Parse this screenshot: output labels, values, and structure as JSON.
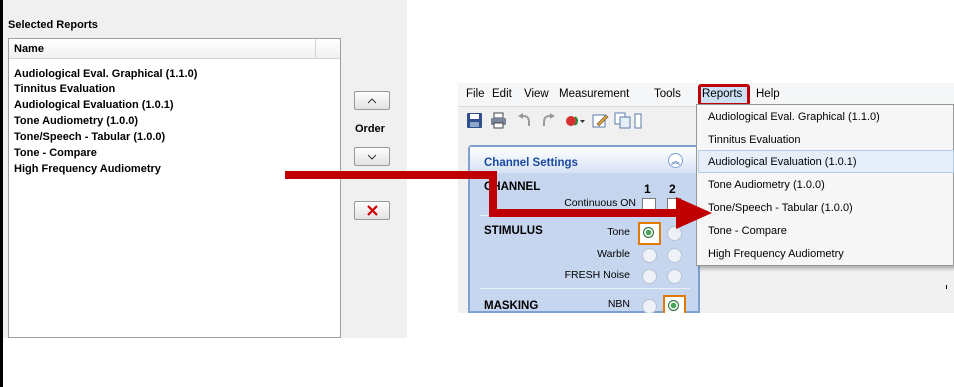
{
  "left_panel": {
    "title": "Selected Reports",
    "column_header": "Name",
    "items": [
      "Audiological Eval. Graphical (1.1.0)",
      "Tinnitus Evaluation",
      "Audiological Evaluation (1.0.1)",
      "Tone Audiometry (1.0.0)",
      "Tone/Speech - Tabular (1.0.0)",
      "Tone - Compare",
      "High Frequency Audiometry"
    ],
    "order_label": "Order",
    "up_icon": "chevron-up-icon",
    "down_icon": "chevron-down-icon",
    "remove_icon": "close-icon"
  },
  "app": {
    "menu": [
      "File",
      "Edit",
      "View",
      "Measurement",
      "Tools",
      "Reports",
      "Help"
    ],
    "active_menu": "Reports",
    "toolbar_icons": [
      "save-icon",
      "print-icon",
      "undo-icon",
      "redo-icon",
      "audiometer-icon",
      "edit-icon",
      "copy-icon"
    ],
    "channel_panel": {
      "title": "Channel Settings",
      "sections": {
        "channel": "CHANNEL",
        "stimulus": "STIMULUS",
        "masking": "MASKING"
      },
      "columns": [
        "1",
        "2"
      ],
      "rows": {
        "continuous": "Continuous ON",
        "tone": "Tone",
        "warble": "Warble",
        "fresh_noise": "FRESH Noise",
        "nbn": "NBN"
      }
    },
    "reports_menu": [
      "Audiological Eval. Graphical (1.1.0)",
      "Tinnitus Evaluation",
      "Audiological Evaluation (1.0.1)",
      "Tone Audiometry (1.0.0)",
      "Tone/Speech - Tabular (1.0.0)",
      "Tone - Compare",
      "High Frequency Audiometry"
    ],
    "hovered_report": "Audiological Evaluation (1.0.1)"
  },
  "colors": {
    "annotation": "#c00000",
    "panel_blue": "#c6d6ef",
    "title_blue": "#1a4aa0"
  }
}
